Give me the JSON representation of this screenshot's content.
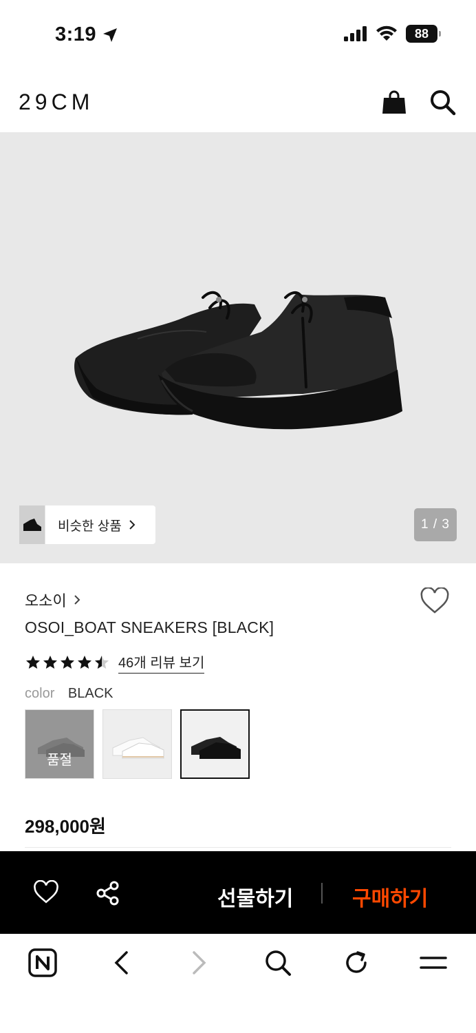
{
  "status_bar": {
    "time": "3:19",
    "battery": "88"
  },
  "header": {
    "logo": "29CM"
  },
  "hero": {
    "similar_label": "비슷한 상품",
    "pager": "1 / 3"
  },
  "product": {
    "brand": "오소이",
    "title": "OSOI_BOAT SNEAKERS [BLACK]",
    "rating": 4.5,
    "review_link": "46개 리뷰 보기",
    "color_label": "color",
    "color_value": "BLACK",
    "swatches": [
      {
        "name": "gray",
        "badge": "품절"
      },
      {
        "name": "white"
      },
      {
        "name": "black",
        "selected": true
      }
    ],
    "price": "298,000원"
  },
  "action_bar": {
    "gift_label": "선물하기",
    "buy_label": "구매하기",
    "buy_color": "#ff4800"
  },
  "browser_toolbar": {
    "icons": [
      "naver-icon",
      "back-icon",
      "forward-icon",
      "search-icon",
      "reload-icon",
      "menu-icon"
    ]
  }
}
